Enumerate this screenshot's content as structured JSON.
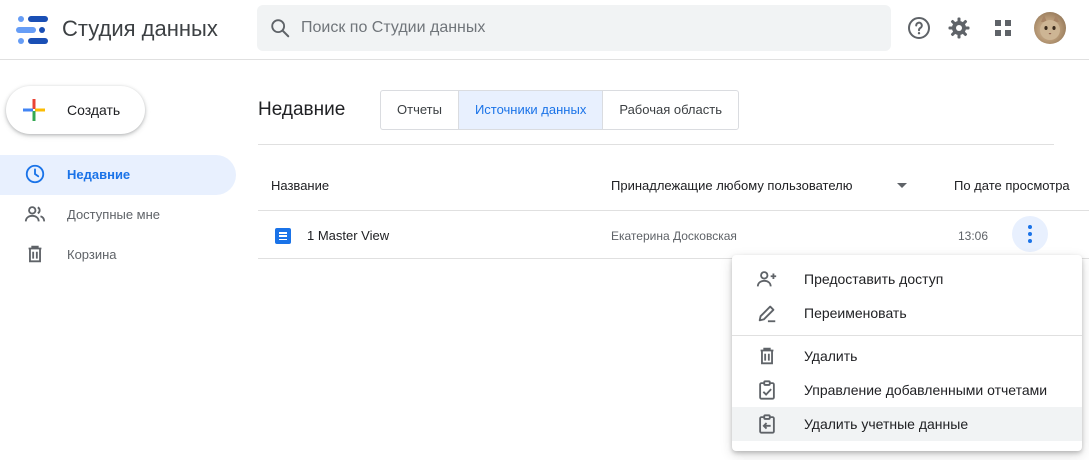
{
  "header": {
    "app_title": "Студия данных",
    "search_placeholder": "Поиск по Студии данных",
    "icons": [
      "logo-icon",
      "search-icon",
      "help-icon",
      "gear-icon",
      "apps-grid-icon",
      "avatar"
    ]
  },
  "sidebar": {
    "create_label": "Создать",
    "items": [
      {
        "label": "Недавние",
        "icon": "clock-icon",
        "active": true
      },
      {
        "label": "Доступные мне",
        "icon": "people-icon",
        "active": false
      },
      {
        "label": "Корзина",
        "icon": "trash-icon",
        "active": false
      }
    ]
  },
  "main": {
    "section_title": "Недавние",
    "tabs": [
      {
        "label": "Отчеты",
        "active": false
      },
      {
        "label": "Источники данных",
        "active": true
      },
      {
        "label": "Рабочая область",
        "active": false
      }
    ],
    "columns": {
      "name": "Название",
      "owner": "Принадлежащие любому пользователю",
      "date": "По дате просмотра"
    },
    "rows": [
      {
        "name": "1 Master View",
        "owner": "Екатерина Досковская",
        "time": "13:06",
        "icon": "data-source-icon"
      }
    ]
  },
  "context_menu": {
    "items": [
      {
        "label": "Предоставить доступ",
        "icon": "person-add-icon"
      },
      {
        "label": "Переименовать",
        "icon": "pencil-icon"
      },
      {
        "label": "Удалить",
        "icon": "trash-icon"
      },
      {
        "label": "Управление добавленными отчетами",
        "icon": "clipboard-check-icon"
      },
      {
        "label": "Удалить учетные данные",
        "icon": "clipboard-arrow-icon",
        "hovered": true
      }
    ]
  },
  "colors": {
    "accent": "#1a73e8",
    "active_bg": "#e8f0fe",
    "logo_blue_dark": "#1a4fb5",
    "logo_blue_light": "#669df6",
    "plus_red": "#ea4335",
    "plus_yellow": "#fbbc04",
    "plus_green": "#34a853",
    "plus_blue": "#4285f4"
  }
}
